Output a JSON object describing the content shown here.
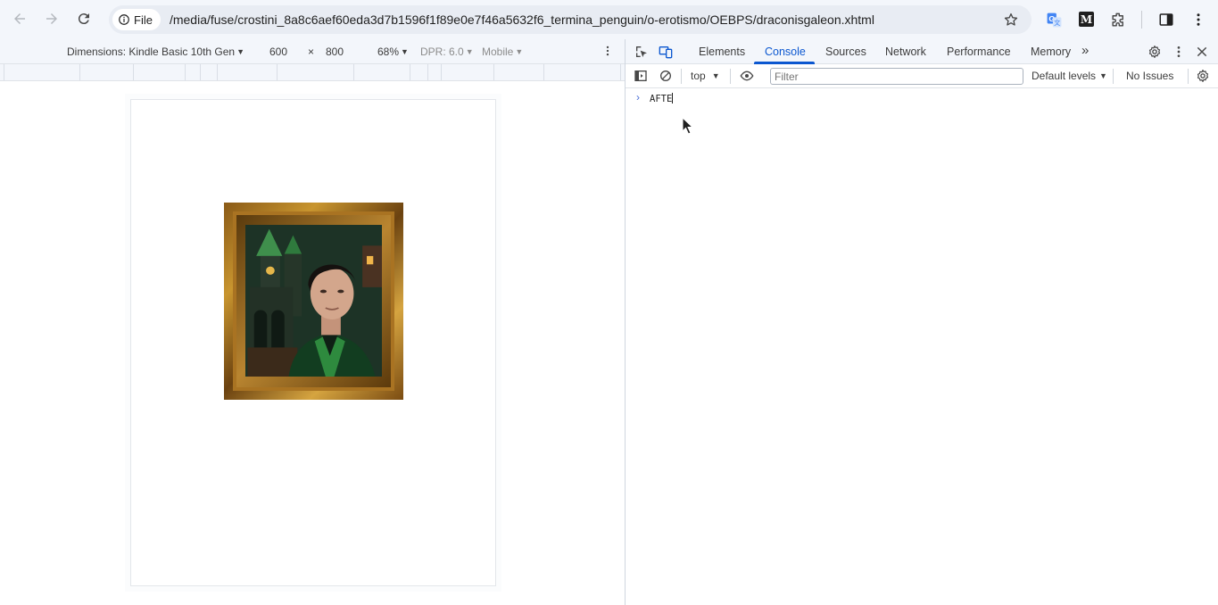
{
  "browser": {
    "site_chip_label": "File",
    "url": "/media/fuse/crostini_8a8c6aef60eda3d7b1596f1f89e0e7f46a5632f6_termina_penguin/o-erotismo/OEBPS/draconisgaleon.xhtml",
    "extension_m_label": "M",
    "icons": [
      "back-icon",
      "forward-icon",
      "reload-icon",
      "info-icon",
      "star-icon",
      "translate-icon",
      "puzzle-icon",
      "side-panel-icon",
      "kebab-menu-icon"
    ]
  },
  "device_toolbar": {
    "dimensions_label": "Dimensions: Kindle Basic 10th Gen",
    "width": "600",
    "times": "×",
    "height": "800",
    "zoom": "68%",
    "dpr": "DPR: 6.0",
    "mode": "Mobile"
  },
  "devtools": {
    "tabs": [
      {
        "label": "Elements"
      },
      {
        "label": "Console"
      },
      {
        "label": "Sources"
      },
      {
        "label": "Network"
      },
      {
        "label": "Performance"
      },
      {
        "label": "Memory"
      }
    ],
    "active_tab": "Console",
    "more_tabs": "»",
    "console_toolbar": {
      "context": "top",
      "filter_placeholder": "Filter",
      "levels": "Default levels",
      "issues": "No Issues"
    },
    "console": {
      "prompt": "›",
      "input": "AFTE"
    }
  },
  "colors": {
    "accent": "#0b57d0",
    "chrome_bg": "#f3f6fb",
    "frame_gold": "#c8952f"
  }
}
